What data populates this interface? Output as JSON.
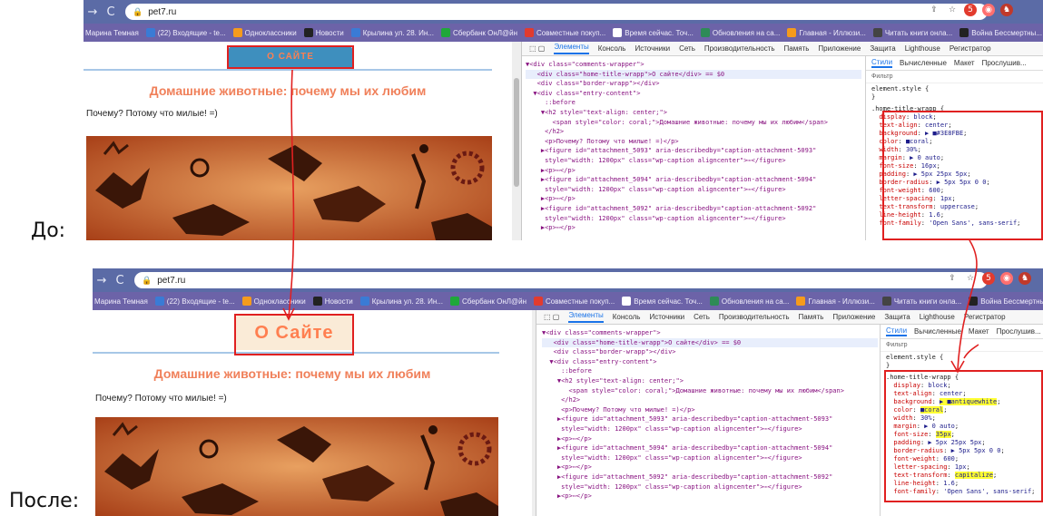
{
  "labels": {
    "before": "До:",
    "after": "После:"
  },
  "browser": {
    "url": "pet7.ru",
    "back": "→",
    "reload": "C",
    "bookmarks": [
      {
        "label": "Марина Темная",
        "color": "#6c63a8"
      },
      {
        "label": "(22) Входящие - te...",
        "color": "#3a7bd5"
      },
      {
        "label": "Одноклассники",
        "color": "#f59b1c"
      },
      {
        "label": "Новости",
        "color": "#222222"
      },
      {
        "label": "Крылина ул. 28. Ин...",
        "color": "#3a7bd5"
      },
      {
        "label": "Сбербанк ОнЛ@йн",
        "color": "#1fa83a"
      },
      {
        "label": "Совместные покуп...",
        "color": "#e23b2e"
      },
      {
        "label": "Время сейчас. Точ...",
        "color": "#ffffff"
      },
      {
        "label": "Обновления на са...",
        "color": "#2e8b57"
      },
      {
        "label": "Главная - Иллюзи...",
        "color": "#f59b1c"
      },
      {
        "label": "Читать книги онла...",
        "color": "#444444"
      },
      {
        "label": "Война Бессмертны...",
        "color": "#222222"
      }
    ]
  },
  "before": {
    "home_title": "О САЙТЕ",
    "home_title_bg": "#3E8FBE",
    "home_title_color": "coral"
  },
  "after": {
    "home_title": "О Сайте",
    "home_title_bg": "antiquewhite",
    "home_title_color": "coral"
  },
  "page": {
    "heading": "Домашние животные: почему мы их любим",
    "paragraph": "Почему? Потому что милые! =)"
  },
  "devtools": {
    "tabs": [
      "Элементы",
      "Консоль",
      "Источники",
      "Сеть",
      "Производительность",
      "Память",
      "Приложение",
      "Защита",
      "Lighthouse",
      "Регистратор"
    ],
    "styles_tabs": [
      "Стили",
      "Вычисленные",
      "Макет",
      "Прослушив..."
    ],
    "filter": "Фильтр",
    "element_style": "element.style {",
    "dom_lines": [
      "▼<div class=\"comments-wrapper\">",
      "   <div class=\"home-title-wrapp\">О сайте</div> == $0",
      "   <div class=\"border-wrapp\"></div>",
      "  ▼<div class=\"entry-content\">",
      "     ::before",
      "    ▼<h2 style=\"text-align: center;\">",
      "       <span style=\"color: coral;\">Домашние животные: почему мы их любим</span>",
      "     </h2>",
      "     <p>Почему? Потому что милые! =)</p>",
      "    ▶<figure id=\"attachment_5093\" aria-describedby=\"caption-attachment-5093\"",
      "     style=\"width: 1200px\" class=\"wp-caption aligncenter\">⋯</figure>",
      "    ▶<p>⋯</p>",
      "    ▶<figure id=\"attachment_5094\" aria-describedby=\"caption-attachment-5094\"",
      "     style=\"width: 1200px\" class=\"wp-caption aligncenter\">⋯</figure>",
      "    ▶<p>⋯</p>",
      "    ▶<figure id=\"attachment_5092\" aria-describedby=\"caption-attachment-5092\"",
      "     style=\"width: 1200px\" class=\"wp-caption aligncenter\">⋯</figure>",
      "    ▶<p>⋯</p>"
    ],
    "rule_selector": ".home-title-wrapp {",
    "before_props": [
      [
        "display",
        "block"
      ],
      [
        "text-align",
        "center"
      ],
      [
        "background",
        "▶ ■#3E8FBE"
      ],
      [
        "color",
        "■coral"
      ],
      [
        "width",
        "30%"
      ],
      [
        "margin",
        "▶ 0 auto"
      ],
      [
        "font-size",
        "16px"
      ],
      [
        "padding",
        "▶ 5px 25px 5px"
      ],
      [
        "border-radius",
        "▶ 5px 5px 0 0"
      ],
      [
        "font-weight",
        "600"
      ],
      [
        "letter-spacing",
        "1px"
      ],
      [
        "text-transform",
        "uppercase"
      ],
      [
        "line-height",
        "1.6"
      ],
      [
        "font-family",
        "'Open Sans', sans-serif"
      ]
    ],
    "after_props": [
      [
        "display",
        "block"
      ],
      [
        "text-align",
        "center"
      ],
      [
        "background",
        "▶ ■antiquewhite"
      ],
      [
        "color",
        "■coral"
      ],
      [
        "width",
        "30%"
      ],
      [
        "margin",
        "▶ 0 auto"
      ],
      [
        "font-size",
        "35px"
      ],
      [
        "padding",
        "▶ 5px 25px 5px"
      ],
      [
        "border-radius",
        "▶ 5px 5px 0 0"
      ],
      [
        "font-weight",
        "600"
      ],
      [
        "letter-spacing",
        "1px"
      ],
      [
        "text-transform",
        "capitalize"
      ],
      [
        "line-height",
        "1.6"
      ],
      [
        "font-family",
        "'Open Sans', sans-serif"
      ]
    ],
    "highlighted_after": [
      "background",
      "color",
      "font-size",
      "text-transform"
    ]
  }
}
